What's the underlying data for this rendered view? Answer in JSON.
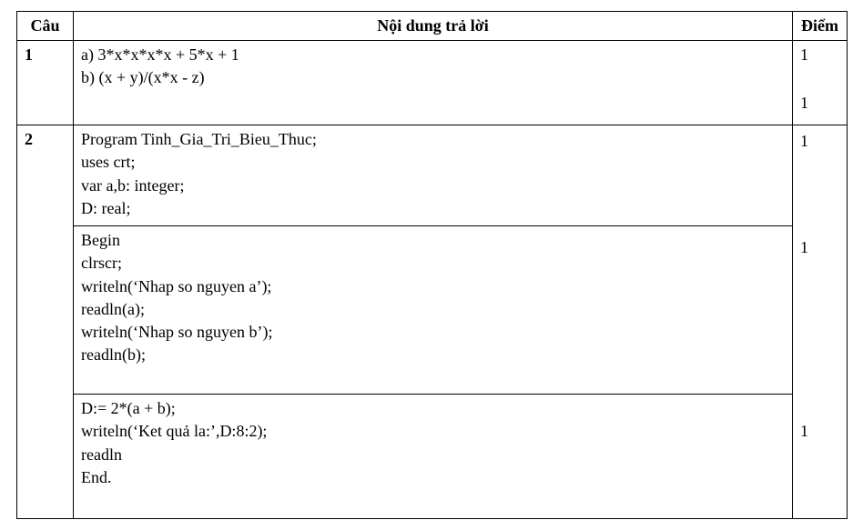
{
  "headers": {
    "col1": "Câu",
    "col2": "Nội dung trả lời",
    "col3": "Điểm"
  },
  "q1": {
    "number": "1",
    "line_a": "a) 3*x*x*x*x + 5*x + 1",
    "line_b": "b) (x + y)/(x*x - z)",
    "score_a": "1",
    "score_b": "1"
  },
  "q2": {
    "number": "2",
    "block1": {
      "l1": "Program Tinh_Gia_Tri_Bieu_Thuc;",
      "l2": "uses crt;",
      "l3": "var a,b: integer;",
      "l4": "D: real;",
      "score": "1"
    },
    "block2": {
      "l1": "Begin",
      "l2": "clrscr;",
      "l3": "writeln(‘Nhap so nguyen a’);",
      "l4": "readln(a);",
      "l5": "writeln(‘Nhap so nguyen b’);",
      "l6": "readln(b);",
      "score": "1"
    },
    "block3": {
      "l1": "D:= 2*(a + b);",
      "l2": "writeln(‘Ket quả la:’,D:8:2);",
      "l3": "readln",
      "l4": "End.",
      "score": "1"
    }
  },
  "chart_data": {
    "type": "table",
    "columns": [
      "Câu",
      "Nội dung trả lời",
      "Điểm"
    ],
    "rows": [
      {
        "cau": "1",
        "noi_dung": "a) 3*x*x*x*x + 5*x + 1",
        "diem": 1
      },
      {
        "cau": "1",
        "noi_dung": "b) (x + y)/(x*x - z)",
        "diem": 1
      },
      {
        "cau": "2",
        "noi_dung": "Program Tinh_Gia_Tri_Bieu_Thuc; uses crt; var a,b: integer; D: real;",
        "diem": 1
      },
      {
        "cau": "2",
        "noi_dung": "Begin clrscr; writeln('Nhap so nguyen a'); readln(a); writeln('Nhap so nguyen b'); readln(b);",
        "diem": 1
      },
      {
        "cau": "2",
        "noi_dung": "D:= 2*(a + b); writeln('Ket quả la:',D:8:2); readln End.",
        "diem": 1
      }
    ]
  }
}
